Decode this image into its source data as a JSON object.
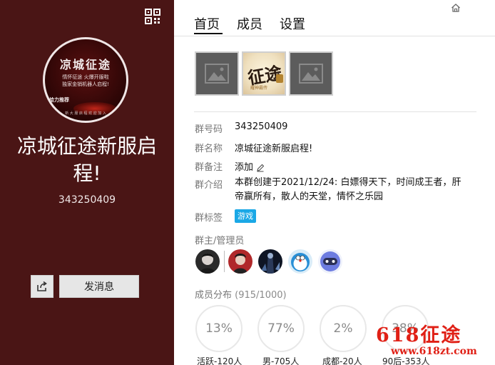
{
  "group": {
    "name": "凉城征途新服启程!",
    "id": "343250409",
    "avatar_text": {
      "title": "凉城征途",
      "line1": "情怀征途 火爆开服啦",
      "line2": "独家金销机器人启程!",
      "line3": "给力推荐",
      "line4": "新 大 服 启 程 欢 迎 加 入"
    }
  },
  "left": {
    "send_message_label": "发消息"
  },
  "tabs": [
    {
      "label": "首页"
    },
    {
      "label": "成员"
    },
    {
      "label": "设置"
    }
  ],
  "photos": {
    "art": {
      "main": "征途",
      "sub": "耀神霸传"
    }
  },
  "info": {
    "group_number_label": "群号码",
    "group_number": "343250409",
    "group_name_label": "群名称",
    "group_name": "凉城征途新服启程!",
    "remark_label": "群备注",
    "remark_add": "添加",
    "intro_label": "群介绍",
    "intro": "本群创建于2021/12/24: 白嫖得天下，时间成王者，肝帝赢所有，散人的天堂，情怀之乐园",
    "tags_label": "群标签",
    "tag": "游戏"
  },
  "admins": {
    "title": "群主/管理员"
  },
  "distribution": {
    "title": "成员分布",
    "count": "(915/1000)",
    "items": [
      {
        "percent": "13%",
        "label": "活跃-120人"
      },
      {
        "percent": "77%",
        "label": "男-705人"
      },
      {
        "percent": "2%",
        "label": "成都-20人"
      },
      {
        "percent": "38%",
        "label": "90后-353人"
      }
    ]
  },
  "watermark": {
    "main": "618征途",
    "url": "www.618zt.com"
  },
  "colors": {
    "left_bg": "#4a1515",
    "tag_bg": "#1aa8e6",
    "watermark": "#e02016"
  }
}
